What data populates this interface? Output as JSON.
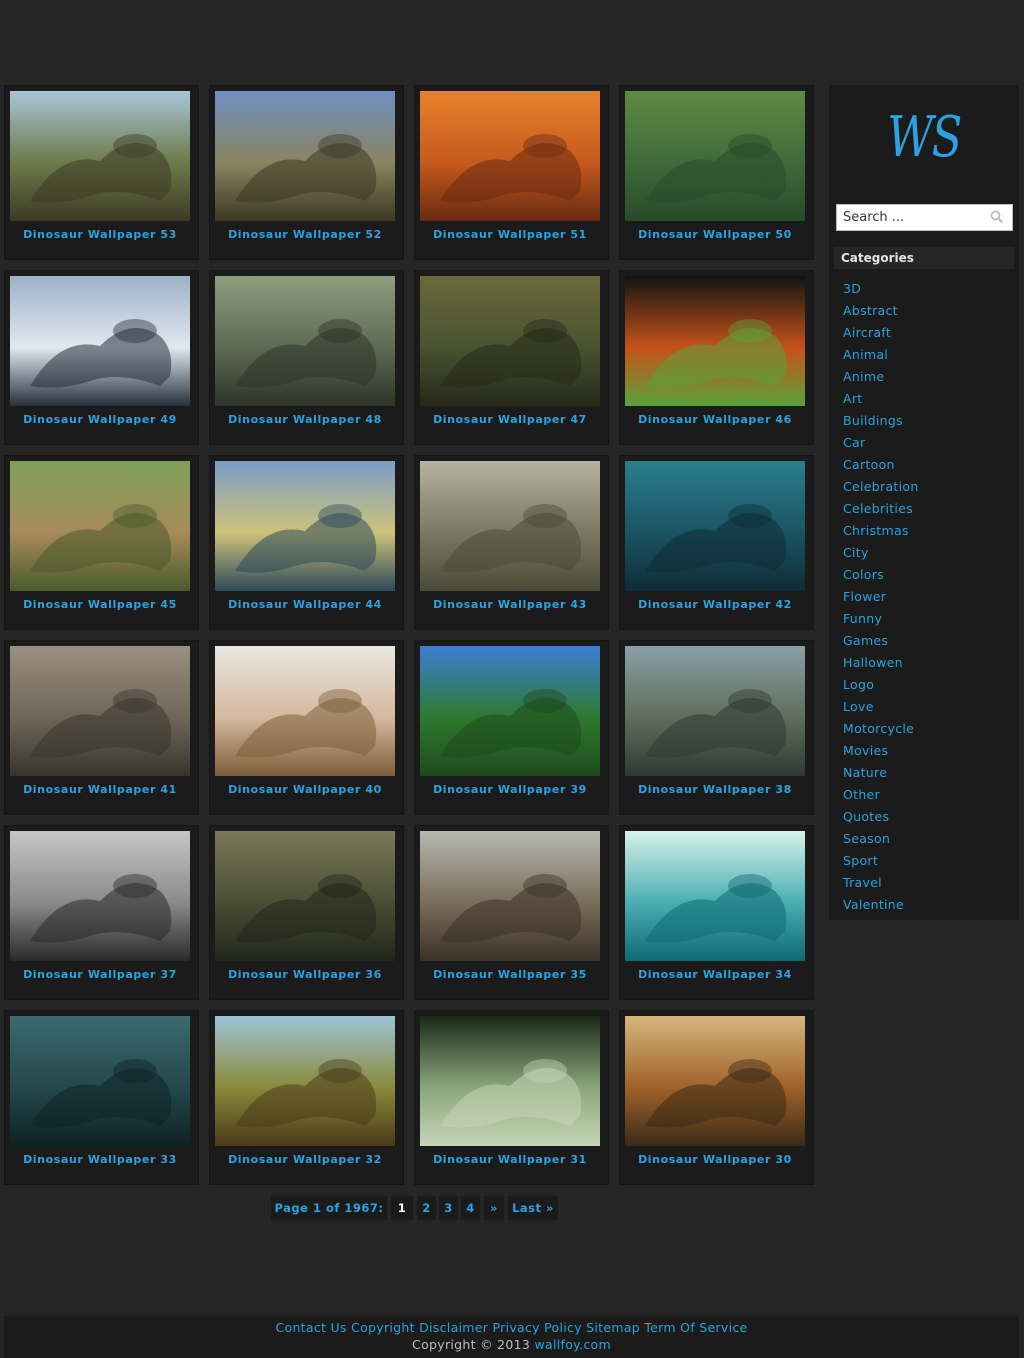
{
  "wallpapers": [
    {
      "title": "Dinosaur Wallpaper 53",
      "palette": [
        "#a9c6d8",
        "#6d7a4a",
        "#3c3a24"
      ]
    },
    {
      "title": "Dinosaur Wallpaper 52",
      "palette": [
        "#6f8fc2",
        "#8a8460",
        "#3c3824"
      ]
    },
    {
      "title": "Dinosaur Wallpaper 51",
      "palette": [
        "#e7822a",
        "#c65a1d",
        "#6a2a12"
      ]
    },
    {
      "title": "Dinosaur Wallpaper 50",
      "palette": [
        "#5f8a44",
        "#3f6a3a",
        "#284a2a"
      ]
    },
    {
      "title": "Dinosaur Wallpaper 49",
      "palette": [
        "#9cb1c8",
        "#e2e8ee",
        "#24313c"
      ]
    },
    {
      "title": "Dinosaur Wallpaper 48",
      "palette": [
        "#8e9e7e",
        "#5e6a54",
        "#2e3427"
      ]
    },
    {
      "title": "Dinosaur Wallpaper 47",
      "palette": [
        "#6a6a3a",
        "#4a5230",
        "#262a1a"
      ]
    },
    {
      "title": "Dinosaur Wallpaper 46",
      "palette": [
        "#101410",
        "#c7521a",
        "#5aa23a"
      ]
    },
    {
      "title": "Dinosaur Wallpaper 45",
      "palette": [
        "#7ea05a",
        "#a88a5c",
        "#4a5a2c"
      ]
    },
    {
      "title": "Dinosaur Wallpaper 44",
      "palette": [
        "#7a9ec8",
        "#cfc27a",
        "#2c4a5a"
      ]
    },
    {
      "title": "Dinosaur Wallpaper 43",
      "palette": [
        "#b6b2a0",
        "#7a7a62",
        "#4a4a3a"
      ]
    },
    {
      "title": "Dinosaur Wallpaper 42",
      "palette": [
        "#2a7e8e",
        "#1a5462",
        "#0e2c36"
      ]
    },
    {
      "title": "Dinosaur Wallpaper 41",
      "palette": [
        "#9a9080",
        "#6e6658",
        "#3a352c"
      ]
    },
    {
      "title": "Dinosaur Wallpaper 40",
      "palette": [
        "#e9e7e2",
        "#d6b89e",
        "#7c5e3a"
      ]
    },
    {
      "title": "Dinosaur Wallpaper 39",
      "palette": [
        "#3c7ed6",
        "#2e7a2e",
        "#1e4a1e"
      ]
    },
    {
      "title": "Dinosaur Wallpaper 38",
      "palette": [
        "#8aa0a8",
        "#5e6e5a",
        "#2e3a34"
      ]
    },
    {
      "title": "Dinosaur Wallpaper 37",
      "palette": [
        "#c6c6c6",
        "#8a8a8a",
        "#2a2a2a"
      ]
    },
    {
      "title": "Dinosaur Wallpaper 36",
      "palette": [
        "#7a7a5a",
        "#4a4e34",
        "#22261a"
      ]
    },
    {
      "title": "Dinosaur Wallpaper 35",
      "palette": [
        "#b6b8b0",
        "#7a6e5a",
        "#3a3228"
      ]
    },
    {
      "title": "Dinosaur Wallpaper 34",
      "palette": [
        "#d6f2ea",
        "#4aaeb2",
        "#0e6a72"
      ]
    },
    {
      "title": "Dinosaur Wallpaper 33",
      "palette": [
        "#3c6a6e",
        "#24484c",
        "#0e2224"
      ]
    },
    {
      "title": "Dinosaur Wallpaper 32",
      "palette": [
        "#9ec4d8",
        "#8a8a3a",
        "#4a3a1a"
      ]
    },
    {
      "title": "Dinosaur Wallpaper 31",
      "palette": [
        "#1a2a16",
        "#8aa67e",
        "#c6d6b6"
      ]
    },
    {
      "title": "Dinosaur Wallpaper 30",
      "palette": [
        "#d6b67e",
        "#a0622a",
        "#3a2a16"
      ]
    }
  ],
  "sidebar": {
    "logo": "WS",
    "search_placeholder": "Search ...",
    "categories_title": "Categories",
    "categories": [
      "3D",
      "Abstract",
      "Aircraft",
      "Animal",
      "Anime",
      "Art",
      "Buildings",
      "Car",
      "Cartoon",
      "Celebration",
      "Celebrities",
      "Christmas",
      "City",
      "Colors",
      "Flower",
      "Funny",
      "Games",
      "Hallowen",
      "Logo",
      "Love",
      "Motorcycle",
      "Movies",
      "Nature",
      "Other",
      "Quotes",
      "Season",
      "Sport",
      "Travel",
      "Valentine"
    ]
  },
  "pagination": {
    "info": "Page 1 of 1967:",
    "current": "1",
    "pages": [
      "2",
      "3",
      "4"
    ],
    "next": "»",
    "last": "Last »"
  },
  "footer": {
    "links": [
      "Contact Us",
      "Copyright",
      "Disclaimer",
      "Privacy Policy",
      "Sitemap",
      "Term Of Service"
    ],
    "copyright_prefix": "Copyright © 2013",
    "site": "wallfoy.com"
  },
  "colors": {
    "accent": "#2aa3e0",
    "background": "#262626",
    "panel": "#1b1b1b"
  }
}
